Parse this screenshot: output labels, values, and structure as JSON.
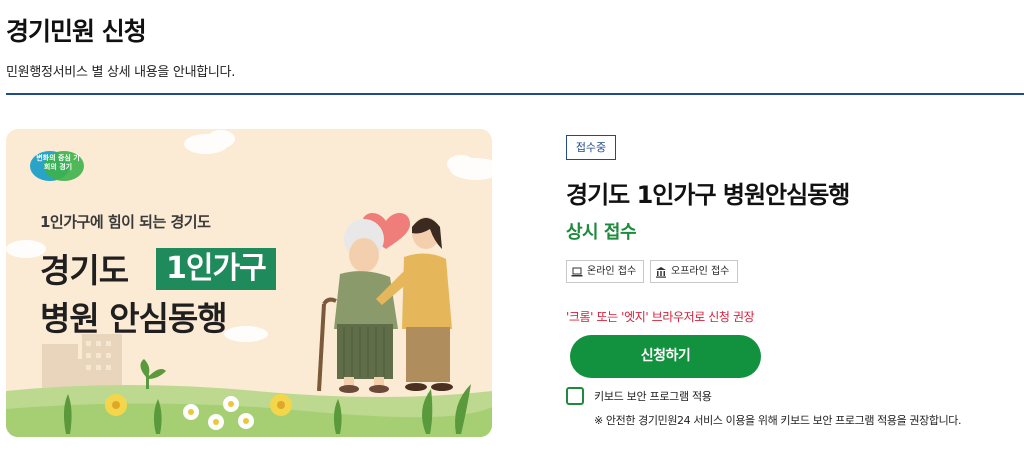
{
  "header": {
    "title": "경기민원 신청",
    "subtitle": "민원행정서비스 별 상세 내용을 안내합니다."
  },
  "banner": {
    "logo_text": "변화의 중심 기회의 경기",
    "subheading": "1인가구에 힘이 되는 경기도",
    "line1": "경기도",
    "highlight": "1인가구",
    "line2": "병원 안심동행"
  },
  "service": {
    "status_badge": "접수중",
    "title": "경기도 1인가구 병원안심동행",
    "period": "상시 접수"
  },
  "channels": [
    {
      "label": "온라인 접수",
      "icon": "laptop-icon"
    },
    {
      "label": "오프라인 접수",
      "icon": "building-icon"
    }
  ],
  "browser_notice": "'크롬' 또는 '엣지' 브라우저로 신청 권장",
  "apply_button": "신청하기",
  "keyboard_security": {
    "label": "키보드 보안 프로그램 적용",
    "note": "※ 안전한 경기민원24 서비스 이용을 위해 키보드 보안 프로그램 적용을 권장합니다.",
    "checked": false
  },
  "colors": {
    "accent_green": "#12913e",
    "header_rule": "#1f4a8c",
    "notice_red": "#d8203b",
    "banner_bg": "#fbead4"
  }
}
